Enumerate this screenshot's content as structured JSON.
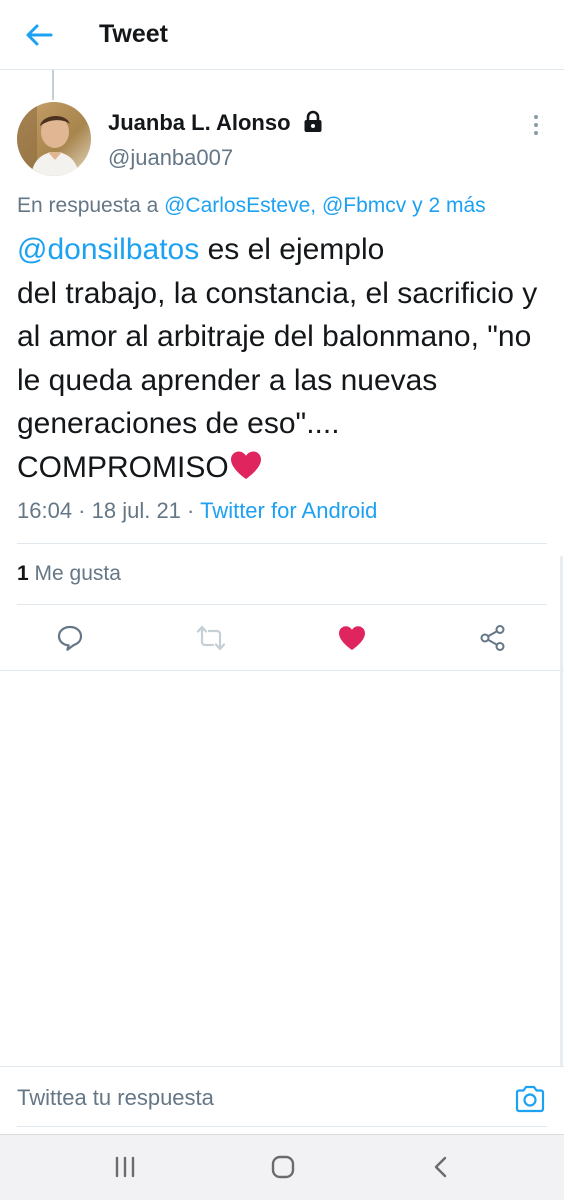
{
  "header": {
    "title": "Tweet"
  },
  "tweet": {
    "display_name": "Juanba L. Alonso",
    "handle": "@juanba007",
    "reply_prefix": "En respuesta a ",
    "reply_targets": "@CarlosEsteve, @Fbmcv y 2 más",
    "mention": "@donsilbatos",
    "text_line1_rest": " es el ejemplo",
    "text_rest": "del trabajo, la constancia, el sacrificio y al amor al arbitraje del balonmano, \"no le queda aprender a las nuevas generaciones de eso\".... COMPROMISO",
    "time": "16:04",
    "date": "18 jul. 21",
    "source": "Twitter for Android",
    "likes_count": "1",
    "likes_label": "Me gusta"
  },
  "reply": {
    "placeholder": "Twittea tu respuesta"
  },
  "icons": {
    "back": "arrow-left-icon",
    "lock": "lock-icon",
    "more": "vertical-dots-icon",
    "reply": "comment-icon",
    "retweet": "retweet-icon",
    "like": "heart-icon",
    "share": "share-icon",
    "camera": "camera-icon",
    "recents": "recents-icon",
    "home": "home-icon",
    "back_nav": "chevron-left-icon"
  },
  "colors": {
    "accent": "#1da1f2",
    "like_active": "#e0245e",
    "secondary_text": "#657786"
  },
  "state": {
    "liked": true
  }
}
